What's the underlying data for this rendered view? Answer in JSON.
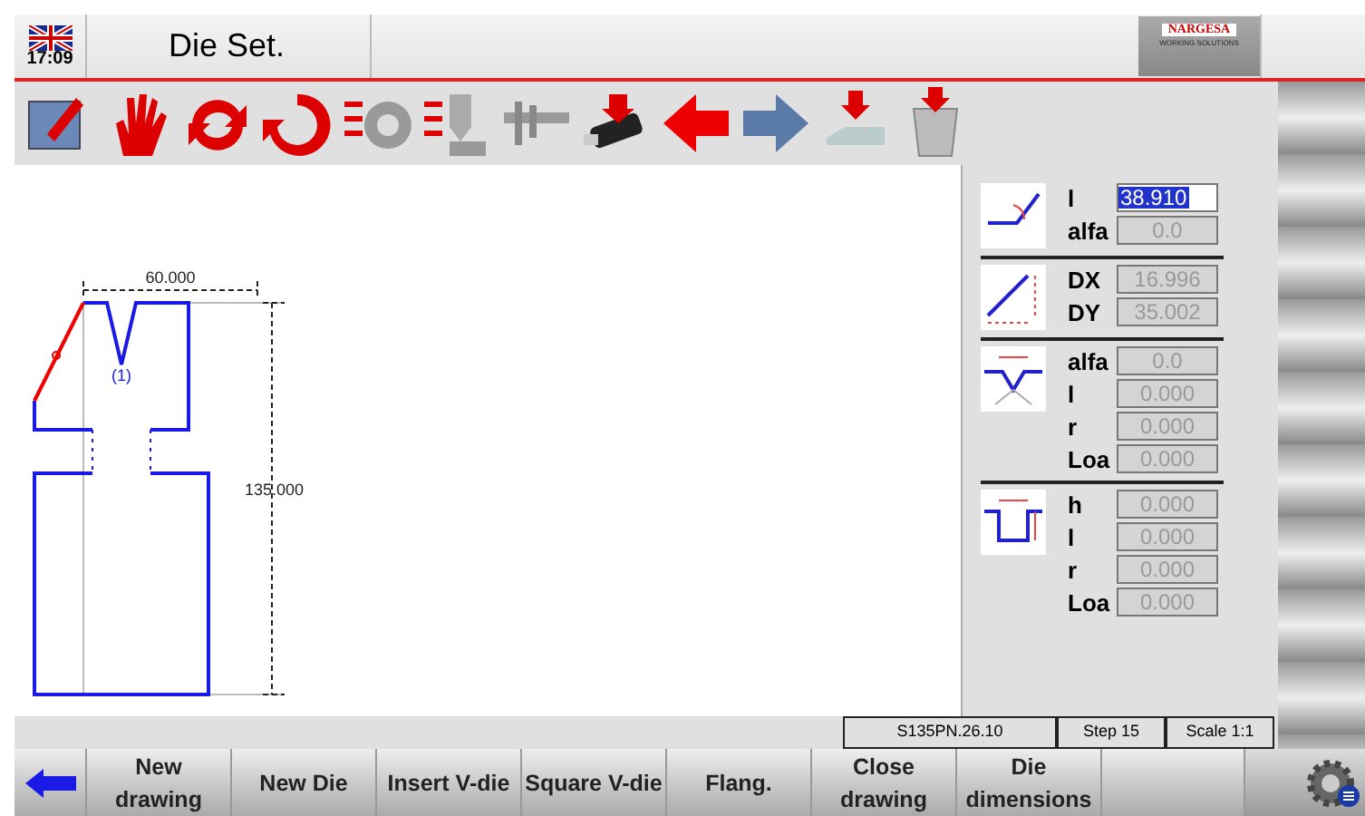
{
  "header": {
    "time": "17:09",
    "title": "Die Set.",
    "logo": {
      "name": "NARGESA",
      "tagline": "WORKING SOLUTIONS"
    }
  },
  "drawing": {
    "width_dim": "60.000",
    "height_dim": "135.000",
    "v_label": "(1)"
  },
  "panel": [
    {
      "rows": [
        {
          "label": "l",
          "value": "38.910",
          "selected": true,
          "disabled": false
        },
        {
          "label": "alfa",
          "value": "0.0",
          "selected": false,
          "disabled": true
        }
      ]
    },
    {
      "rows": [
        {
          "label": "DX",
          "value": "16.996",
          "selected": false,
          "disabled": true
        },
        {
          "label": "DY",
          "value": "35.002",
          "selected": false,
          "disabled": true
        }
      ]
    },
    {
      "rows": [
        {
          "label": "alfa",
          "value": "0.0",
          "selected": false,
          "disabled": true
        },
        {
          "label": "l",
          "value": "0.000",
          "selected": false,
          "disabled": true
        },
        {
          "label": "r",
          "value": "0.000",
          "selected": false,
          "disabled": true
        },
        {
          "label": "Loa",
          "value": "0.000",
          "selected": false,
          "disabled": true
        }
      ]
    },
    {
      "rows": [
        {
          "label": "h",
          "value": "0.000",
          "selected": false,
          "disabled": true
        },
        {
          "label": "l",
          "value": "0.000",
          "selected": false,
          "disabled": true
        },
        {
          "label": "r",
          "value": "0.000",
          "selected": false,
          "disabled": true
        },
        {
          "label": "Loa",
          "value": "0.000",
          "selected": false,
          "disabled": true
        }
      ]
    }
  ],
  "status_bar": [
    "S135PN.26.10",
    "Step 15",
    "Scale 1:1"
  ],
  "buttons": [
    {
      "kind": "back"
    },
    {
      "kind": "text",
      "label": "New drawing"
    },
    {
      "kind": "text",
      "label": "New Die"
    },
    {
      "kind": "text",
      "label": "Insert V-die"
    },
    {
      "kind": "text",
      "label": "Square V-die"
    },
    {
      "kind": "text",
      "label": "Flang."
    },
    {
      "kind": "text",
      "label": "Close drawing"
    },
    {
      "kind": "text",
      "label": "Die dimensions"
    },
    {
      "kind": "empty"
    }
  ]
}
